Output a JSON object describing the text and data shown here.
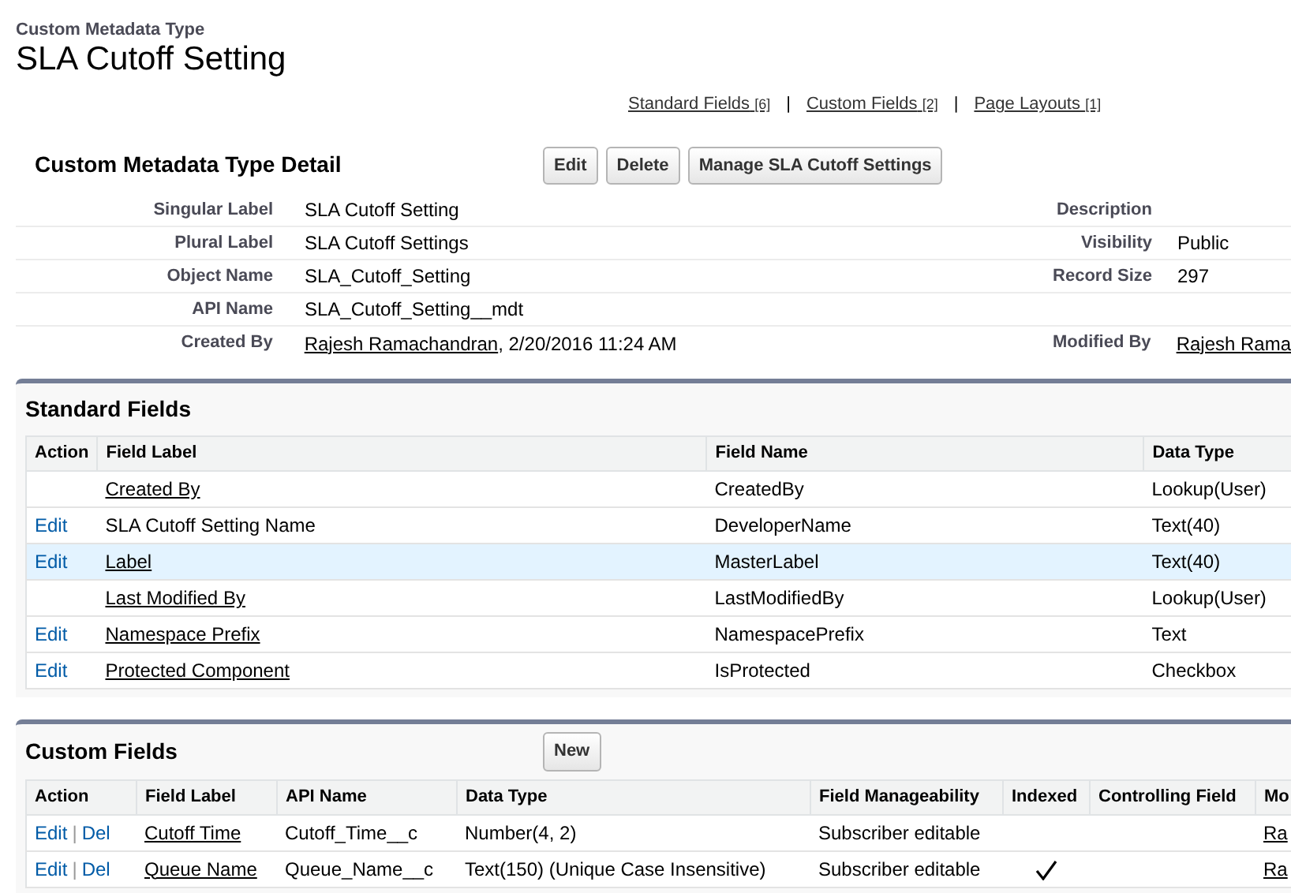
{
  "header": {
    "type_label": "Custom Metadata Type",
    "title": "SLA Cutoff Setting"
  },
  "related_links": [
    {
      "label": "Standard Fields",
      "count": "[6]"
    },
    {
      "label": "Custom Fields",
      "count": "[2]"
    },
    {
      "label": "Page Layouts",
      "count": "[1]"
    }
  ],
  "link_separator": "|",
  "detail": {
    "title": "Custom Metadata Type Detail",
    "buttons": [
      "Edit",
      "Delete",
      "Manage SLA Cutoff Settings"
    ],
    "rows": [
      {
        "left_label": "Singular Label",
        "left_value": "SLA Cutoff Setting",
        "right_label": "Description"
      },
      {
        "left_label": "Plural Label",
        "left_value": "SLA Cutoff Settings",
        "right_label": "Visibility",
        "right_value": "Public"
      },
      {
        "left_label": "Object Name",
        "left_value": "SLA_Cutoff_Setting",
        "right_label": "Record Size",
        "right_value": "297"
      },
      {
        "left_label": "API Name",
        "left_value": "SLA_Cutoff_Setting__mdt"
      },
      {
        "left_label": "Created By",
        "left_link": "Rajesh Ramachandran",
        "left_value": ", 2/20/2016 11:24 AM",
        "right_label": "Modified By",
        "right_link": "Rajesh Rama"
      }
    ]
  },
  "standard_fields": {
    "title": "Standard Fields",
    "columns": [
      "Action",
      "Field Label",
      "Field Name",
      "Data Type"
    ],
    "rows": [
      {
        "action": "",
        "label": "Created By",
        "link": true,
        "name": "CreatedBy",
        "type": "Lookup(User)",
        "highlighted": false
      },
      {
        "action": "Edit",
        "label": "SLA Cutoff Setting Name",
        "link": false,
        "name": "DeveloperName",
        "type": "Text(40)",
        "highlighted": false
      },
      {
        "action": "Edit",
        "label": "Label",
        "link": true,
        "name": "MasterLabel",
        "type": "Text(40)",
        "highlighted": true
      },
      {
        "action": "",
        "label": "Last Modified By",
        "link": true,
        "name": "LastModifiedBy",
        "type": "Lookup(User)",
        "highlighted": false
      },
      {
        "action": "Edit",
        "label": "Namespace Prefix",
        "link": true,
        "name": "NamespacePrefix",
        "type": "Text",
        "highlighted": false
      },
      {
        "action": "Edit",
        "label": "Protected Component",
        "link": true,
        "name": "IsProtected",
        "type": "Checkbox",
        "highlighted": false
      }
    ]
  },
  "custom_fields": {
    "title": "Custom Fields",
    "new_button": "New",
    "columns": [
      "Action",
      "Field Label",
      "API Name",
      "Data Type",
      "Field Manageability",
      "Indexed",
      "Controlling Field",
      "Mo"
    ],
    "rows": [
      {
        "edit": "Edit",
        "separator": "|",
        "del": "Del",
        "label": "Cutoff Time",
        "api": "Cutoff_Time__c",
        "type": "Number(4, 2)",
        "manageability": "Subscriber editable",
        "indexed": false,
        "modified": "Ra"
      },
      {
        "edit": "Edit",
        "separator": "|",
        "del": "Del",
        "label": "Queue Name",
        "api": "Queue_Name__c",
        "type": "Text(150) (Unique Case Insensitive)",
        "manageability": "Subscriber editable",
        "indexed": true,
        "modified": "Ra"
      }
    ]
  }
}
